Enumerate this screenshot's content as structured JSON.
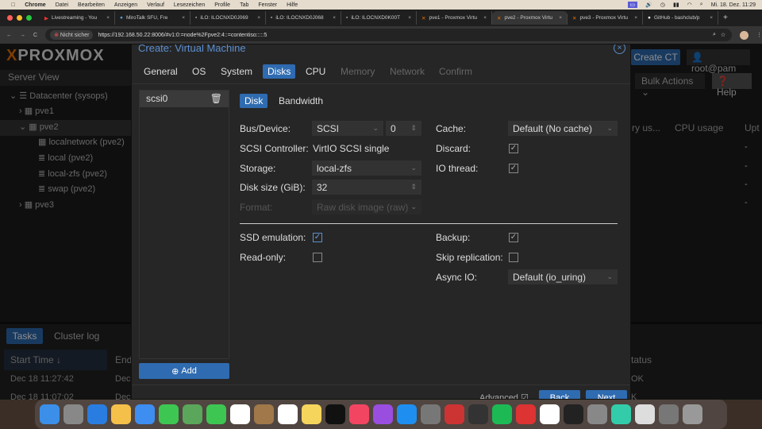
{
  "menubar": {
    "app": "Chrome",
    "items": [
      "Datei",
      "Bearbeiten",
      "Anzeigen",
      "Verlauf",
      "Lesezeichen",
      "Profile",
      "Tab",
      "Fenster",
      "Hilfe"
    ],
    "clock": "Mi. 18. Dez. 11:29"
  },
  "browser": {
    "tabs": [
      {
        "title": "Livestreaming - You",
        "icon": "youtube-icon"
      },
      {
        "title": "MiroTalk SFU, Fre",
        "icon": "mirotalk-icon"
      },
      {
        "title": "iLO: ILOCNXD0J069",
        "icon": "ilo-icon"
      },
      {
        "title": "iLO: ILOCNXD0J068",
        "icon": "ilo-icon"
      },
      {
        "title": "iLO: ILOCNXD0K00T",
        "icon": "ilo-icon"
      },
      {
        "title": "pve1 - Proxmox Virtu",
        "icon": "proxmox-icon"
      },
      {
        "title": "pve2 - Proxmox Virtu",
        "icon": "proxmox-icon",
        "active": true
      },
      {
        "title": "pve3 - Proxmox Virtu",
        "icon": "proxmox-icon"
      },
      {
        "title": "GitHub - bashclub/p",
        "icon": "github-icon"
      }
    ],
    "security": "Nicht sicher",
    "url": "https://192.168.50.22:8006/#v1:0:=node%2Fpve2:4::=contentiso:::::5"
  },
  "proxmox": {
    "logo": "PROXMOX",
    "server_view": "Server View",
    "tree": [
      "Datacenter (sysops)",
      "pve1",
      "pve2",
      "localnetwork (pve2)",
      "local (pve2)",
      "local-zfs (pve2)",
      "swap (pve2)",
      "pve3"
    ],
    "create_ct": "Create CT",
    "user": "root@pam",
    "bulk_actions": "Bulk Actions",
    "help": "Help",
    "columns": [
      "ry us...",
      "CPU usage",
      "Upt"
    ],
    "rows": [
      "-",
      "-",
      "-",
      "-"
    ],
    "bottom_tabs": [
      "Tasks",
      "Cluster log"
    ],
    "task_columns": [
      "Start Time ↓",
      "End",
      "tatus"
    ],
    "task_rows": [
      [
        "Dec 18 11:27:42",
        "Dec",
        "OK"
      ],
      [
        "Dec 18 11:07:02",
        "Dec",
        "K"
      ]
    ]
  },
  "dialog": {
    "title": "Create: Virtual Machine",
    "tabs": [
      "General",
      "OS",
      "System",
      "Disks",
      "CPU",
      "Memory",
      "Network",
      "Confirm"
    ],
    "active_tab": "Disks",
    "disks": [
      "scsi0"
    ],
    "add": "Add",
    "subtabs": [
      "Disk",
      "Bandwidth"
    ],
    "form": {
      "bus_label": "Bus/Device:",
      "bus": "SCSI",
      "device": "0",
      "controller_label": "SCSI Controller:",
      "controller": "VirtIO SCSI single",
      "storage_label": "Storage:",
      "storage": "local-zfs",
      "size_label": "Disk size (GiB):",
      "size": "32",
      "format_label": "Format:",
      "format": "Raw disk image (raw)",
      "cache_label": "Cache:",
      "cache": "Default (No cache)",
      "discard_label": "Discard:",
      "discard": true,
      "iothread_label": "IO thread:",
      "iothread": true,
      "ssd_label": "SSD emulation:",
      "ssd": true,
      "readonly_label": "Read-only:",
      "readonly": false,
      "backup_label": "Backup:",
      "backup": true,
      "skiprep_label": "Skip replication:",
      "skiprep": false,
      "asyncio_label": "Async IO:",
      "asyncio": "Default (io_uring)"
    },
    "advanced": "Advanced",
    "back": "Back",
    "next": "Next"
  },
  "dock": [
    "Finder",
    "Launchpad",
    "Safari",
    "Photos",
    "Mail",
    "Messages",
    "Maps",
    "FaceTime",
    "Calendar 18",
    "Contacts",
    "Reminders",
    "Notes",
    "TV",
    "Music",
    "Podcasts",
    "App Store",
    "System Settings",
    "Scrobbles",
    "QuickTime",
    "Spotify",
    "Tomato",
    "Chrome",
    "Terminal",
    "Calculator",
    "Sync",
    "Document",
    "Downloads",
    "Trash"
  ]
}
